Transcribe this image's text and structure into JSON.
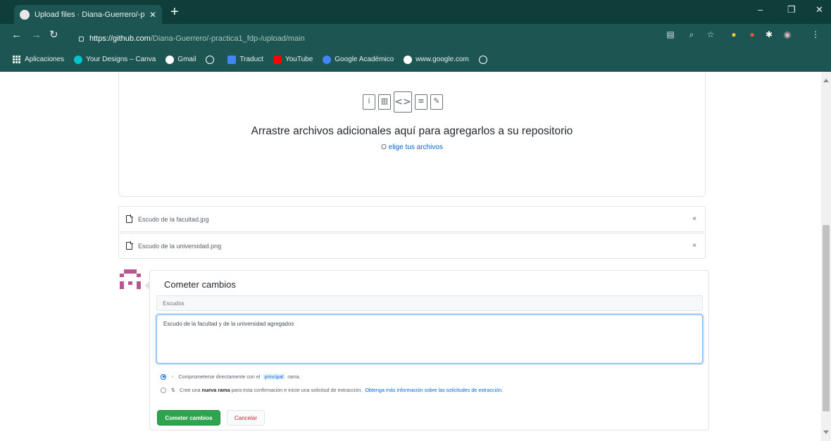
{
  "browser": {
    "tab_title": "Upload files · Diana-Guerrero/-p",
    "tab_close": "✕",
    "new_tab": "+",
    "url_host": "https://github.com",
    "url_path": "/Diana-Guerrero/-practica1_fdp-/upload/main",
    "window_controls": {
      "minimize": "–",
      "maximize": "❐",
      "close": "✕"
    }
  },
  "bookmarks": [
    {
      "label": "Aplicaciones",
      "icon": "apps-grid-icon"
    },
    {
      "label": "Your Designs – Canva",
      "icon": "canva-icon",
      "color": "#00c4cc"
    },
    {
      "label": "Gmail",
      "icon": "google-icon",
      "color": "#ffffff"
    },
    {
      "label": "",
      "icon": "globe-icon",
      "color": "#ffffff"
    },
    {
      "label": "Traduct",
      "icon": "translate-icon",
      "color": "#4285f4"
    },
    {
      "label": "YouTube",
      "icon": "youtube-icon",
      "color": "#ff0000"
    },
    {
      "label": "Google Académico",
      "icon": "scholar-icon",
      "color": "#4285f4"
    },
    {
      "label": "www.google.com",
      "icon": "google-icon",
      "color": "#ffffff"
    },
    {
      "label": "",
      "icon": "globe-icon",
      "color": "#ffffff"
    }
  ],
  "upload": {
    "title": "Arrastre archivos adicionales aquí para agregarlos a su repositorio",
    "subtitle_prefix": "O ",
    "subtitle_link": "elige tus archivos"
  },
  "files": [
    {
      "name": "Escudo de la facultad.jpg",
      "remove": "×"
    },
    {
      "name": "Escudo de la universidad.png",
      "remove": "×"
    }
  ],
  "commit": {
    "title": "Cometer cambios",
    "summary_placeholder": "Escudos",
    "description": "Escudo de la facultad y de la universidad agregados",
    "option_direct_prefix": "Comprometerse directamente con el",
    "option_direct_branch": "principal",
    "option_direct_suffix": "rama.",
    "option_new_prefix": "Cree una",
    "option_new_bold": "nueva rama",
    "option_new_suffix": "para esta confirmación e inicie una solicitud de extracción.",
    "option_new_link": "Obtenga más información sobre las solicitudes de extracción.",
    "commit_button": "Cometer cambios",
    "cancel_button": "Cancelar"
  },
  "colors": {
    "chrome_dark": "#0f3d3a",
    "chrome": "#1d5552",
    "link": "#0366d6",
    "primary_button": "#2ea44f",
    "danger": "#cb2431"
  }
}
